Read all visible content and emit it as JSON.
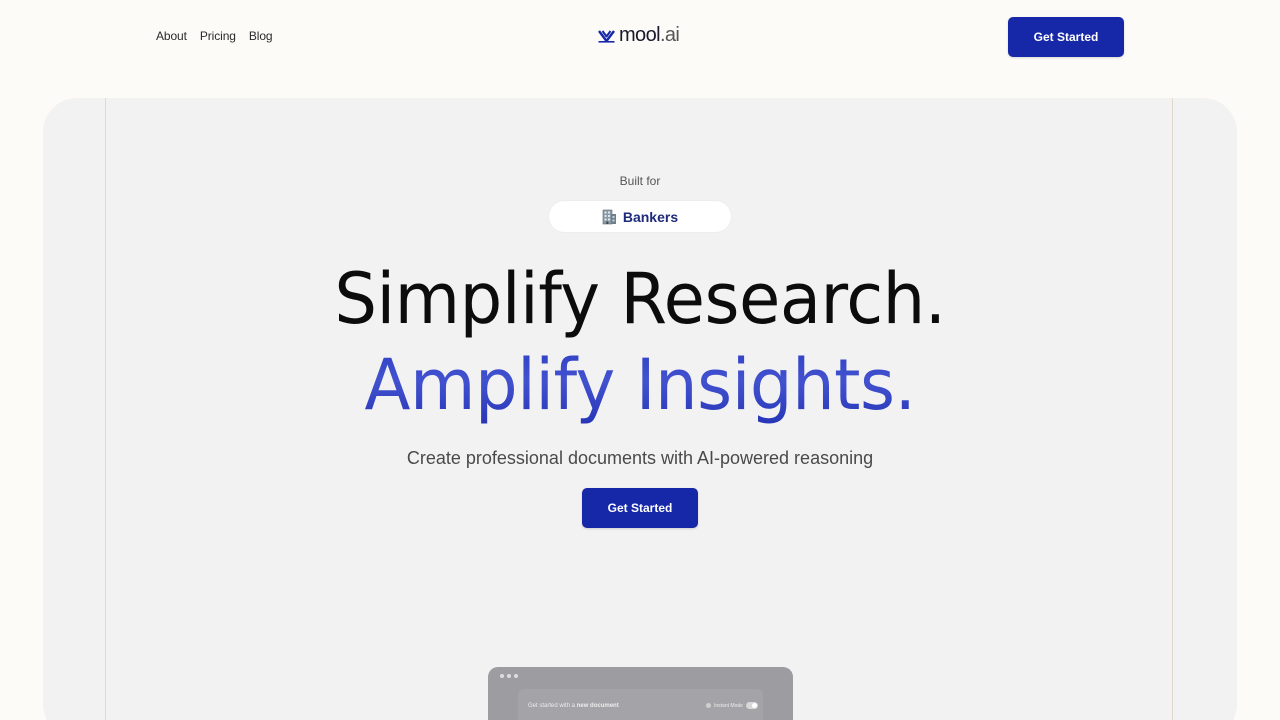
{
  "header": {
    "nav": [
      {
        "label": "About"
      },
      {
        "label": "Pricing"
      },
      {
        "label": "Blog"
      }
    ],
    "logo": {
      "name": "mool",
      "suffix": ".ai",
      "icon": "mool-logo-icon"
    },
    "cta_label": "Get Started"
  },
  "hero": {
    "eyebrow": "Built for",
    "audience": {
      "icon": "office-building-icon",
      "label": "Bankers"
    },
    "headline_line1": "Simplify Research.",
    "headline_line2": "Amplify Insights.",
    "subtitle": "Create professional documents with AI-powered reasoning",
    "cta_label": "Get Started"
  },
  "preview": {
    "prompt_prefix": "Get started with a",
    "prompt_emphasis": "new document",
    "toggle_label": "Instant Mode"
  },
  "colors": {
    "accent": "#1628a8",
    "headline_gradient_start": "#2d3ec2",
    "background": "#fdfbf8",
    "panel": "#f3f2f3"
  }
}
